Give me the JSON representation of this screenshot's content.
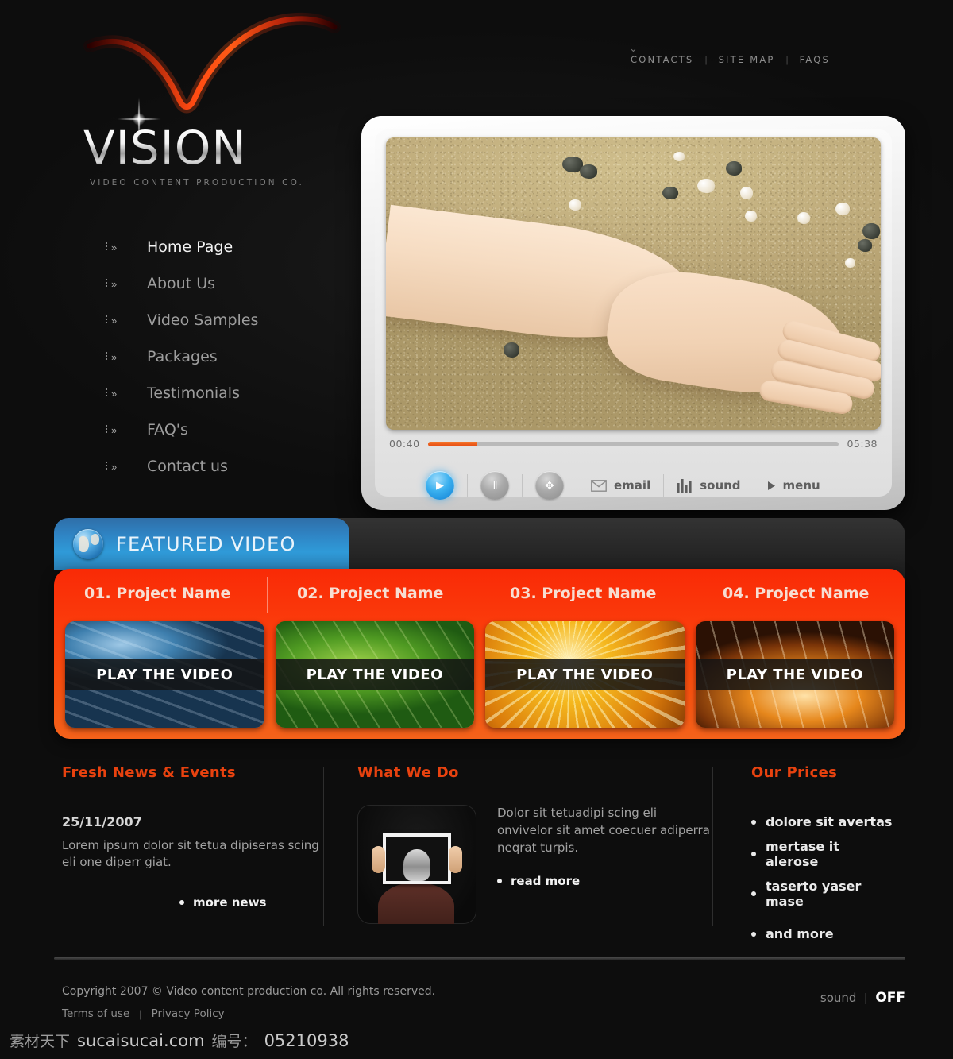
{
  "brand": {
    "name": "VISION",
    "tagline": "VIDEO CONTENT PRODUCTION CO."
  },
  "topnav": {
    "items": [
      {
        "label": "CONTACTS"
      },
      {
        "label": "SITE MAP"
      },
      {
        "label": "FAQS"
      }
    ],
    "separator": "|",
    "chevron": "⌄"
  },
  "sidebar": {
    "items": [
      {
        "label": "Home Page",
        "active": true
      },
      {
        "label": "About Us",
        "active": false
      },
      {
        "label": "Video Samples",
        "active": false
      },
      {
        "label": "Packages",
        "active": false
      },
      {
        "label": "Testimonials",
        "active": false
      },
      {
        "label": "FAQ's",
        "active": false
      },
      {
        "label": "Contact us",
        "active": false
      }
    ]
  },
  "player": {
    "current_time": "00:40",
    "total_time": "05:38",
    "progress_percent": 12,
    "buttons": {
      "play": "▶",
      "pause": "‖",
      "fullscreen": "✥"
    },
    "commands": [
      {
        "label": "email",
        "icon": "envelope-icon"
      },
      {
        "label": "sound",
        "icon": "equalizer-icon"
      },
      {
        "label": "menu",
        "icon": "triangle-right-icon"
      }
    ]
  },
  "featured": {
    "tab_title": "FEATURED VIDEO",
    "tab_icon": "globe-icon",
    "projects": [
      {
        "title": "01. Project Name",
        "cta": "PLAY THE VIDEO",
        "art": "art-water"
      },
      {
        "title": "02. Project Name",
        "cta": "PLAY THE VIDEO",
        "art": "art-leaf"
      },
      {
        "title": "03. Project Name",
        "cta": "PLAY THE VIDEO",
        "art": "art-gold"
      },
      {
        "title": "04. Project Name",
        "cta": "PLAY THE VIDEO",
        "art": "art-fire"
      }
    ]
  },
  "news": {
    "title": "Fresh News & Events",
    "date": "25/11/2007",
    "body": "Lorem ipsum dolor sit tetua dipiseras scing eli one diperr giat.",
    "more_label": "more news"
  },
  "what_we_do": {
    "title": "What We Do",
    "body": "Dolor sit tetuadipi scing eli onvivelor sit amet coecuer adiperra neqrat turpis.",
    "more_label": "read more"
  },
  "prices": {
    "title": "Our Prices",
    "items": [
      "dolore sit avertas",
      "mertase it alerose",
      "taserto yaser mase",
      "and more"
    ]
  },
  "footer": {
    "copyright": "Copyright 2007 © Video content production co. All rights reserved.",
    "links": [
      {
        "label": "Terms of use"
      },
      {
        "label": "Privacy Policy"
      }
    ],
    "separator": "|",
    "sound_label": "sound",
    "sound_divider": "|",
    "sound_value": "OFF"
  },
  "watermark": {
    "cn": "素材天下",
    "site": "sucaisucai.com",
    "label_cn": "编号：",
    "number": "05210938"
  },
  "colors": {
    "accent_red": "#e8420f",
    "panel_red": "#f92a06",
    "tab_blue": "#2f9ad8",
    "play_blue": "#3ab0ef",
    "background": "#0b0b0b"
  }
}
